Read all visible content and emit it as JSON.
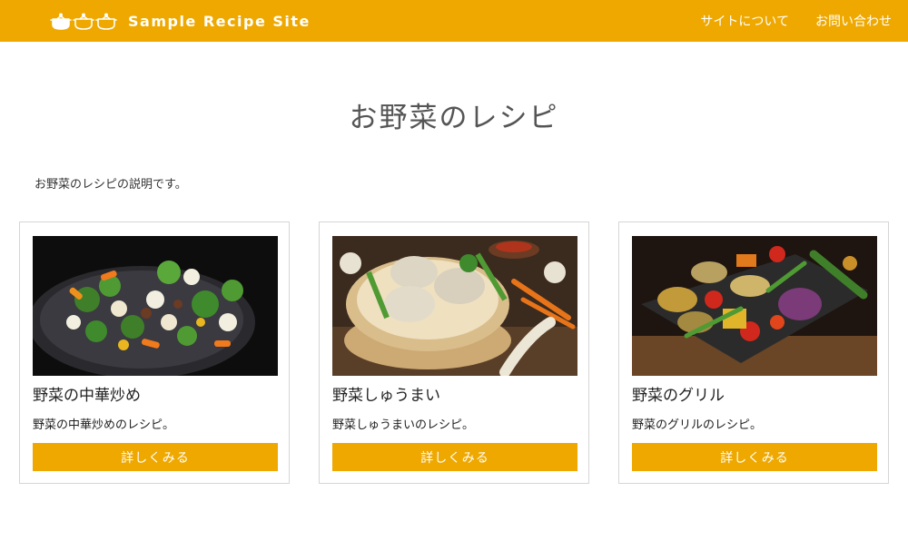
{
  "header": {
    "logo_text": "Sample Recipe Site",
    "logo_icon": "cooking-pots-icon",
    "nav": [
      {
        "label": "サイトについて"
      },
      {
        "label": "お問い合わせ"
      }
    ],
    "colors": {
      "accent": "#eea800",
      "text_on_accent": "#ffffff"
    }
  },
  "main": {
    "title": "お野菜のレシピ",
    "description": "お野菜のレシピの説明です。",
    "cards": [
      {
        "image": "vegetable-stir-fry-photo",
        "title": "野菜の中華炒め",
        "text": "野菜の中華炒めのレシピ。",
        "button_label": "詳しくみる"
      },
      {
        "image": "vegetable-shumai-photo",
        "title": "野菜しゅうまい",
        "text": "野菜しゅうまいのレシピ。",
        "button_label": "詳しくみる"
      },
      {
        "image": "grilled-vegetables-photo",
        "title": "野菜のグリル",
        "text": "野菜のグリルのレシピ。",
        "button_label": "詳しくみる"
      }
    ]
  }
}
